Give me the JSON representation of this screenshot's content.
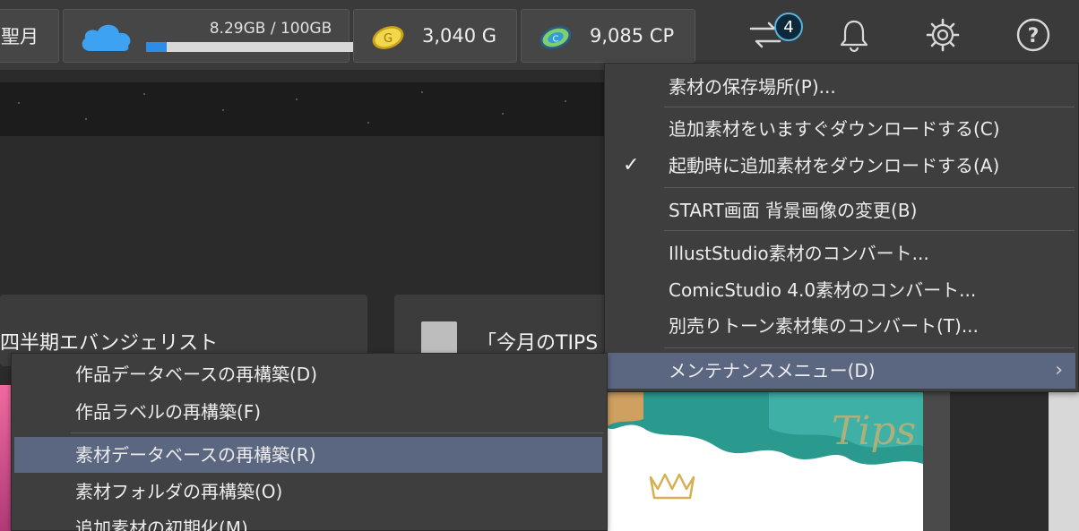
{
  "topbar": {
    "user_name": "聖月",
    "storage": {
      "text": "8.29GB / 100GB",
      "used_fraction": 0.083
    },
    "gold": {
      "value": "3,040 G",
      "icon": "gold-coin-icon"
    },
    "cp": {
      "value": "9,085 CP",
      "icon": "cp-coin-icon"
    },
    "sync_badge_count": "4",
    "icons": [
      "sync-icon",
      "bell-icon",
      "settings-gear-icon",
      "help-icon"
    ]
  },
  "content": {
    "card_left_title": "四半期エバンジェリスト",
    "card_right_title": "「今月のTIPS"
  },
  "main_menu": {
    "items": [
      {
        "label": "素材の保存場所(P)..."
      },
      {
        "label": "追加素材をいますぐダウンロードする(C)"
      },
      {
        "label": "起動時に追加素材をダウンロードする(A)",
        "checked": true
      },
      {
        "label": "START画面 背景画像の変更(B)"
      },
      {
        "label": "IllustStudio素材のコンバート..."
      },
      {
        "label": "ComicStudio 4.0素材のコンバート..."
      },
      {
        "label": "別売りトーン素材集のコンバート(T)..."
      },
      {
        "label": "メンテナンスメニュー(D)",
        "submenu": true,
        "highlighted": true
      }
    ]
  },
  "sub_menu": {
    "items": [
      {
        "label": "作品データベースの再構築(D)"
      },
      {
        "label": "作品ラベルの再構築(F)"
      },
      {
        "label": "素材データベースの再構築(R)",
        "highlighted": true
      },
      {
        "label": "素材フォルダの再構築(O)"
      },
      {
        "label": "追加素材の初期化(M)"
      }
    ]
  },
  "colors": {
    "accent_blue": "#2b8de8",
    "highlight": "#5b6680",
    "badge_border": "#5ab3e0"
  }
}
